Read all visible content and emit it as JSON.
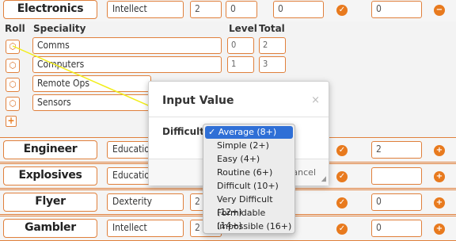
{
  "skills": [
    {
      "name": "Electronics",
      "characteristic": "Intellect",
      "v1": "2",
      "v2": "0",
      "v3": "0",
      "v4": "0",
      "action": "−"
    },
    {
      "name": "Engineer",
      "characteristic": "Education",
      "v4": "2",
      "action": "+"
    },
    {
      "name": "Explosives",
      "characteristic": "Education",
      "v4": "",
      "action": "+"
    },
    {
      "name": "Flyer",
      "characteristic": "Dexterity",
      "v1": "2",
      "v4": "0",
      "action": "+"
    },
    {
      "name": "Gambler",
      "characteristic": "Intellect",
      "v1": "2",
      "v4": "0",
      "action": "+"
    }
  ],
  "specialities": {
    "headers": {
      "roll": "Roll",
      "speciality": "Speciality",
      "level": "Level",
      "total": "Total"
    },
    "rows": [
      {
        "name": "Comms",
        "level": "0",
        "total": "2"
      },
      {
        "name": "Computers",
        "level": "1",
        "total": "3"
      },
      {
        "name": "Remote Ops",
        "level": "",
        "total": ""
      },
      {
        "name": "Sensors",
        "level": "",
        "total": ""
      }
    ],
    "add_label": "+"
  },
  "modal": {
    "title": "Input Value",
    "close": "×",
    "label": "Difficulty:",
    "cancel": "Cancel",
    "resize": "◢"
  },
  "dropdown": {
    "check": "✓",
    "options": [
      "Average (8+)",
      "Simple (2+)",
      "Easy (4+)",
      "Routine (6+)",
      "Difficult (10+)",
      "Very Difficult (12+)",
      "Formidable (14+)",
      "Impossible (16+)"
    ],
    "selected_index": 0
  },
  "icons": {
    "check": "✓",
    "dice": "⬡"
  },
  "colors": {
    "accent": "#e0803c",
    "icon": "#e87a1e",
    "selected": "#2f6fd6",
    "pointer": "#f2ee1a"
  }
}
